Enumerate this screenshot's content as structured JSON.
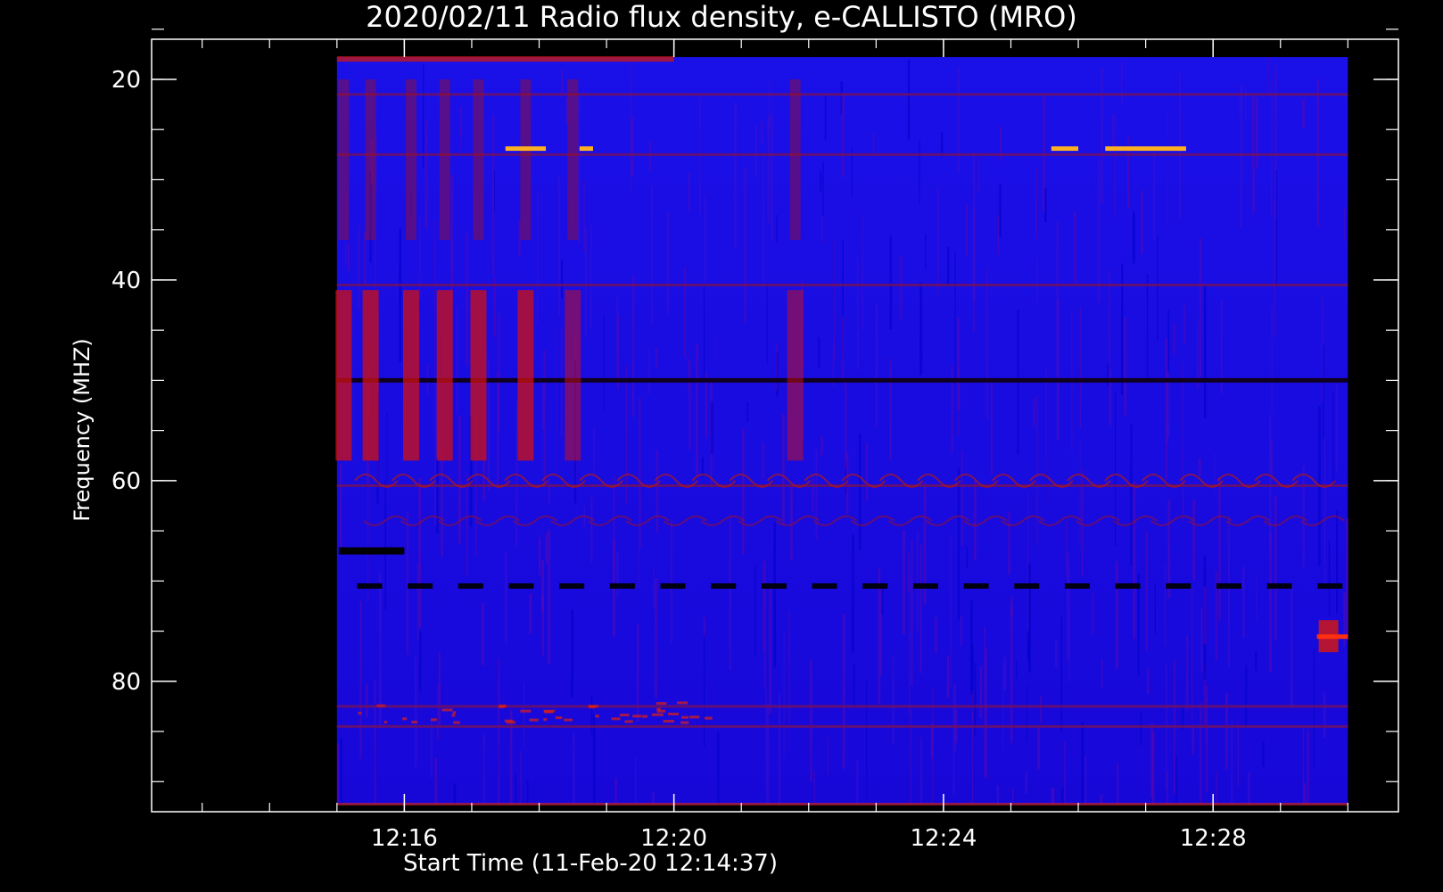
{
  "chart_data": {
    "type": "heatmap",
    "title": "2020/02/11  Radio flux density, e-CALLISTO (MRO)",
    "xlabel": "Start Time (11-Feb-20 12:14:37)",
    "ylabel": "Frequency (MHZ)",
    "x_range_minutes": [
      12.25,
      30.75
    ],
    "x_data_range_minutes": [
      15.0,
      30.0
    ],
    "ylim": [
      16,
      93
    ],
    "y_inverted": true,
    "x_ticks": [
      {
        "value": 16,
        "label": "12:16"
      },
      {
        "value": 20,
        "label": "12:20"
      },
      {
        "value": 24,
        "label": "12:24"
      },
      {
        "value": 28,
        "label": "12:28"
      }
    ],
    "y_ticks": [
      {
        "value": 20,
        "label": "20"
      },
      {
        "value": 40,
        "label": "40"
      },
      {
        "value": 60,
        "label": "60"
      },
      {
        "value": 80,
        "label": "80"
      }
    ],
    "colormap": {
      "low": "#0000ff",
      "mid": "#b01010",
      "high": "#ffff60"
    },
    "features": {
      "horizontal_lines_mhz": [
        21.5,
        27.5,
        40.5,
        50.0,
        60.5,
        82.5,
        84.5
      ],
      "dashed_dark_line_mhz": 70.5,
      "dark_marker_mhz": 67.0,
      "hot_band_mhz": [
        26.5,
        28.0
      ],
      "vertical_bursts_minutes": [
        15.1,
        15.5,
        16.1,
        16.6,
        17.1,
        17.8,
        18.5,
        21.8
      ],
      "late_event": {
        "time": 29.7,
        "freq": 75.5
      }
    }
  }
}
